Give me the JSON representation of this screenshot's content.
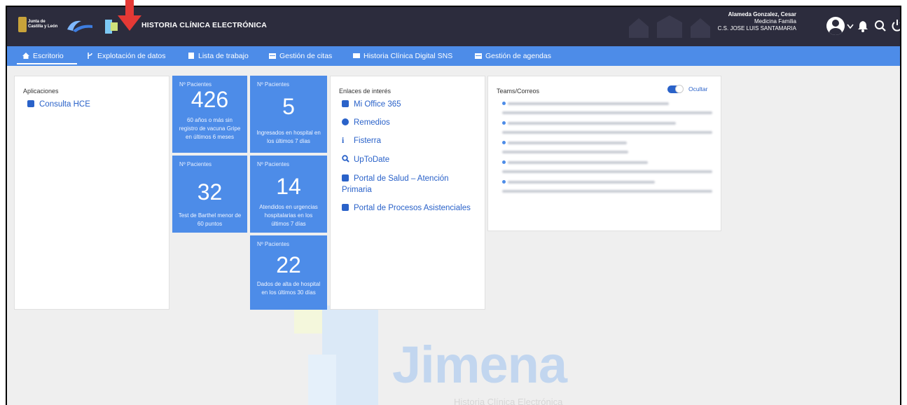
{
  "header": {
    "logo_text": "Junta de Castilla y León",
    "app_title": "HISTORIA CLÍNICA ELECTRÓNICA",
    "user": {
      "name": "Alameda Gonzalez, Cesar",
      "specialty": "Medicina Familia",
      "center": "C.S. JOSE LUIS SANTAMARIA"
    },
    "icons": [
      "user-avatar-icon",
      "chevron-down-icon",
      "bell-icon",
      "search-icon",
      "power-icon"
    ]
  },
  "nav": {
    "items": [
      {
        "label": "Escritorio",
        "icon": "home-icon",
        "active": true
      },
      {
        "label": "Explotación de datos",
        "icon": "branch-icon"
      },
      {
        "label": "Lista de trabajo",
        "icon": "document-icon"
      },
      {
        "label": "Gestión de citas",
        "icon": "calendar-icon"
      },
      {
        "label": "Historia Clínica Digital SNS",
        "icon": "card-icon"
      },
      {
        "label": "Gestión de agendas",
        "icon": "calendar-icon"
      }
    ]
  },
  "aplicaciones": {
    "title": "Aplicaciones",
    "items": [
      {
        "label": "Consulta HCE",
        "icon": "app-icon"
      }
    ]
  },
  "tiles": [
    {
      "label": "Nº Pacientes",
      "value": "426",
      "desc": "60 años o más sin registro de vacuna Gripe en últimos 6 meses"
    },
    {
      "label": "Nº Pacientes",
      "value": "5",
      "desc": "Ingresados en hospital en los últimos 7 días"
    },
    {
      "label": "Nº Pacientes",
      "value": "32",
      "desc": "Test de Barthel menor de 60 puntos"
    },
    {
      "label": "Nº Pacientes",
      "value": "14",
      "desc": "Atendidos en urgencias hospitalarias en los últimos 7 días"
    },
    {
      "label": "Nº Pacientes",
      "value": "22",
      "desc": "Dados de alta de hospital en los últimos 30 días"
    }
  ],
  "enlaces": {
    "title": "Enlaces de interés",
    "items": [
      {
        "label": "Mi Office 365",
        "icon": "office-icon"
      },
      {
        "label": "Remedios",
        "icon": "pills-icon"
      },
      {
        "label": "Fisterra",
        "icon": "info-icon"
      },
      {
        "label": "UpToDate",
        "icon": "search-icon"
      },
      {
        "label": "Portal de Salud – Atención Primaria",
        "icon": "medkit-icon"
      },
      {
        "label": "Portal de Procesos Asistenciales",
        "icon": "process-icon"
      }
    ]
  },
  "teams": {
    "title": "Teams/Correos",
    "toggle_label": "Ocultar",
    "toggle_on": true
  },
  "watermark": {
    "title": "Jimena",
    "subtitle": "Historia Clínica Electrónica"
  },
  "colors": {
    "topbar": "#2c2c3d",
    "navbar": "#4d8ce8",
    "tile": "#4d8ce8",
    "link": "#2a62c9",
    "annotation_arrow": "#e53935"
  }
}
